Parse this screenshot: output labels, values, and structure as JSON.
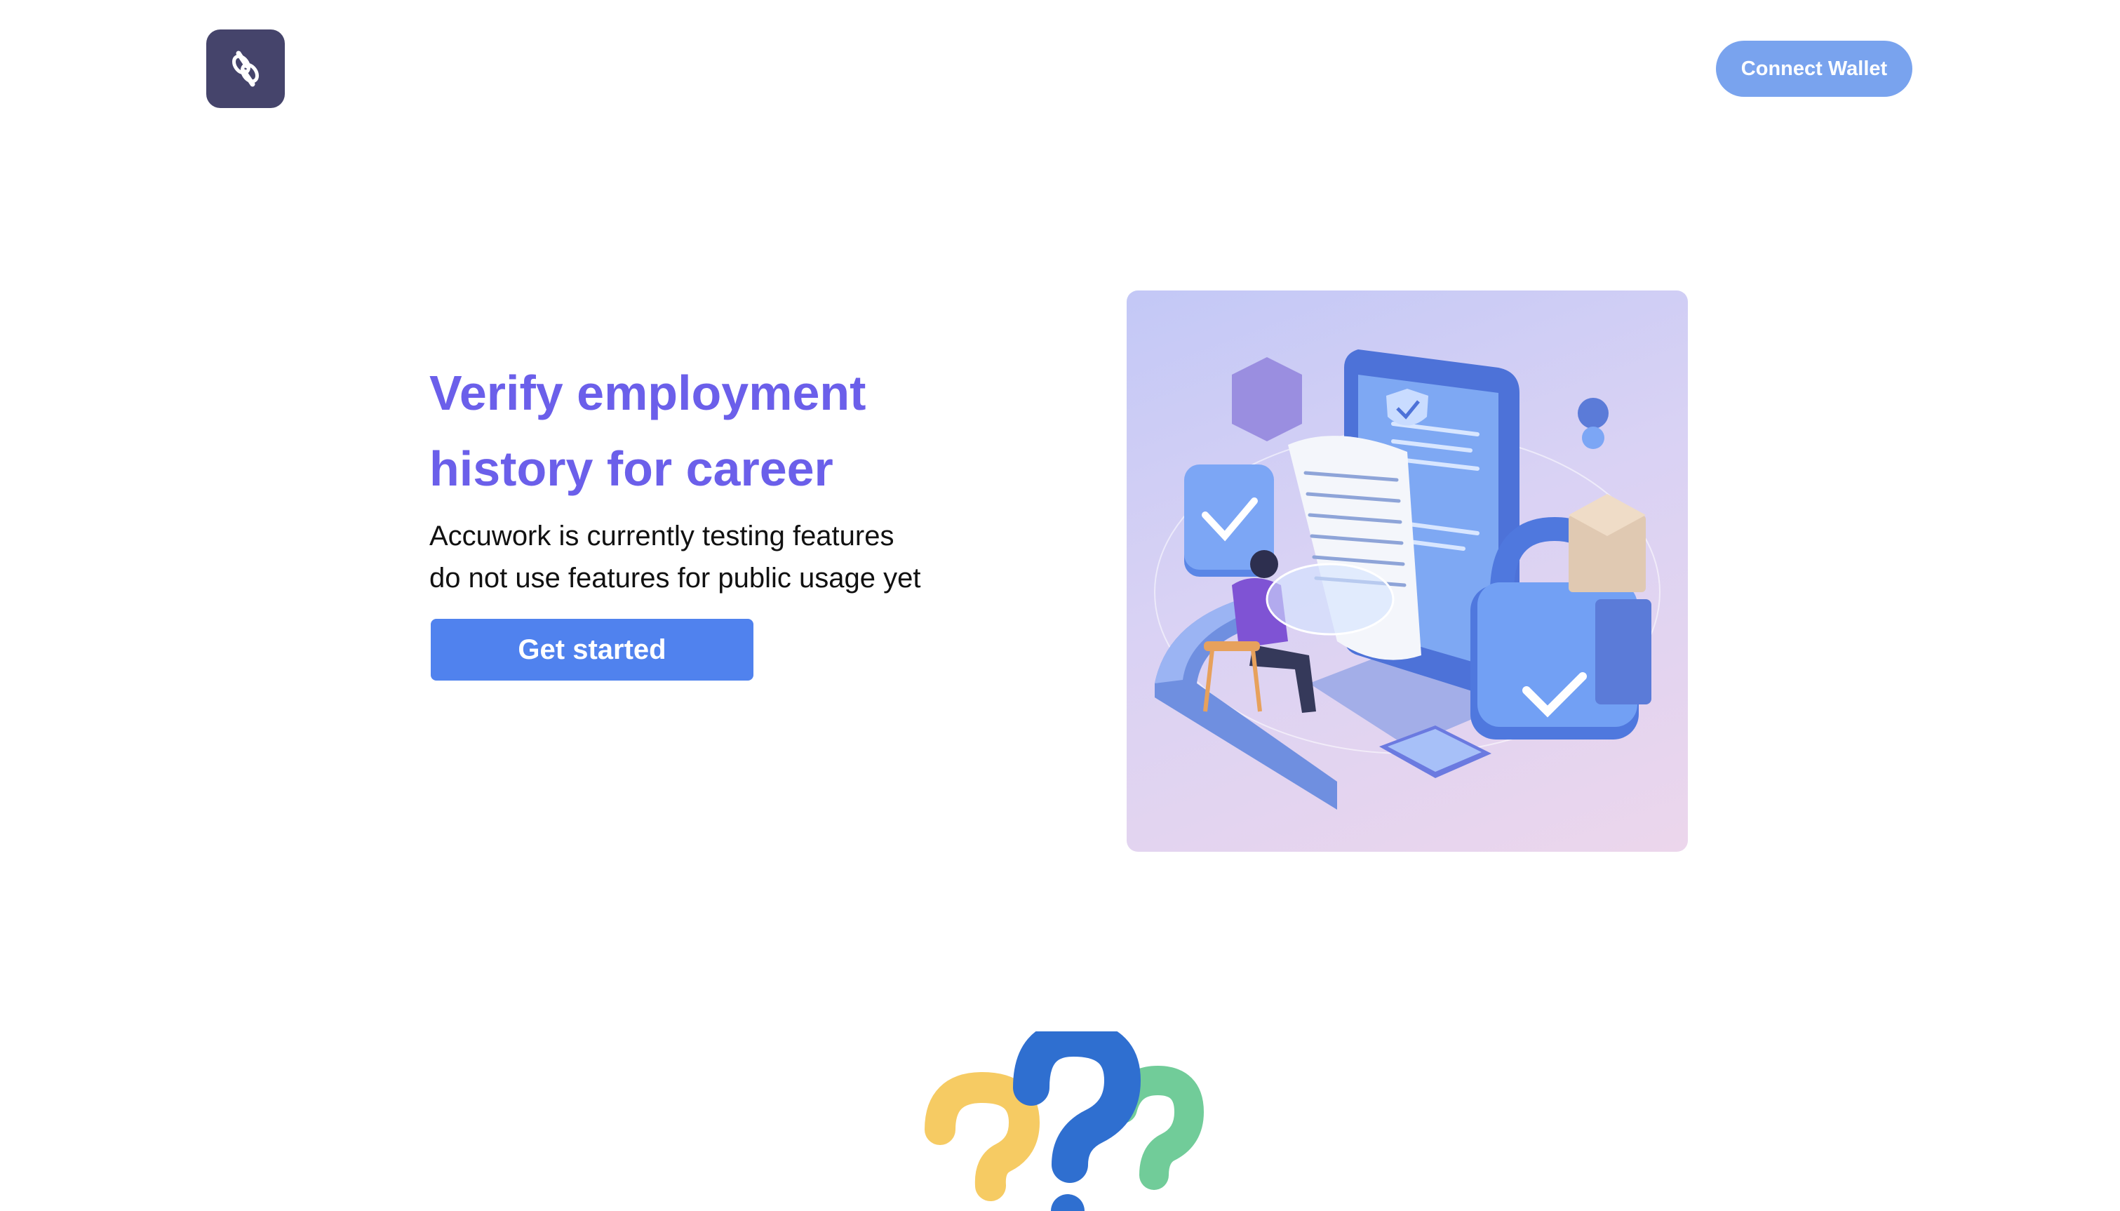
{
  "header": {
    "logo_icon": "chain-link-icon",
    "connect_wallet_label": "Connect Wallet"
  },
  "hero": {
    "title_line1": "Verify employment",
    "title_line2": "history for career",
    "subtitle_line1": "Accuwork is currently testing features",
    "subtitle_line2": "do not use features for public usage yet",
    "cta_label": "Get started",
    "illustration": "isometric-verification-illustration"
  },
  "section2": {
    "illustration": "question-marks-illustration"
  },
  "colors": {
    "title": "#6b5fea",
    "logo_bg": "#45446b",
    "connect_button": "#79a3ee",
    "cta_button": "#5082ee"
  }
}
